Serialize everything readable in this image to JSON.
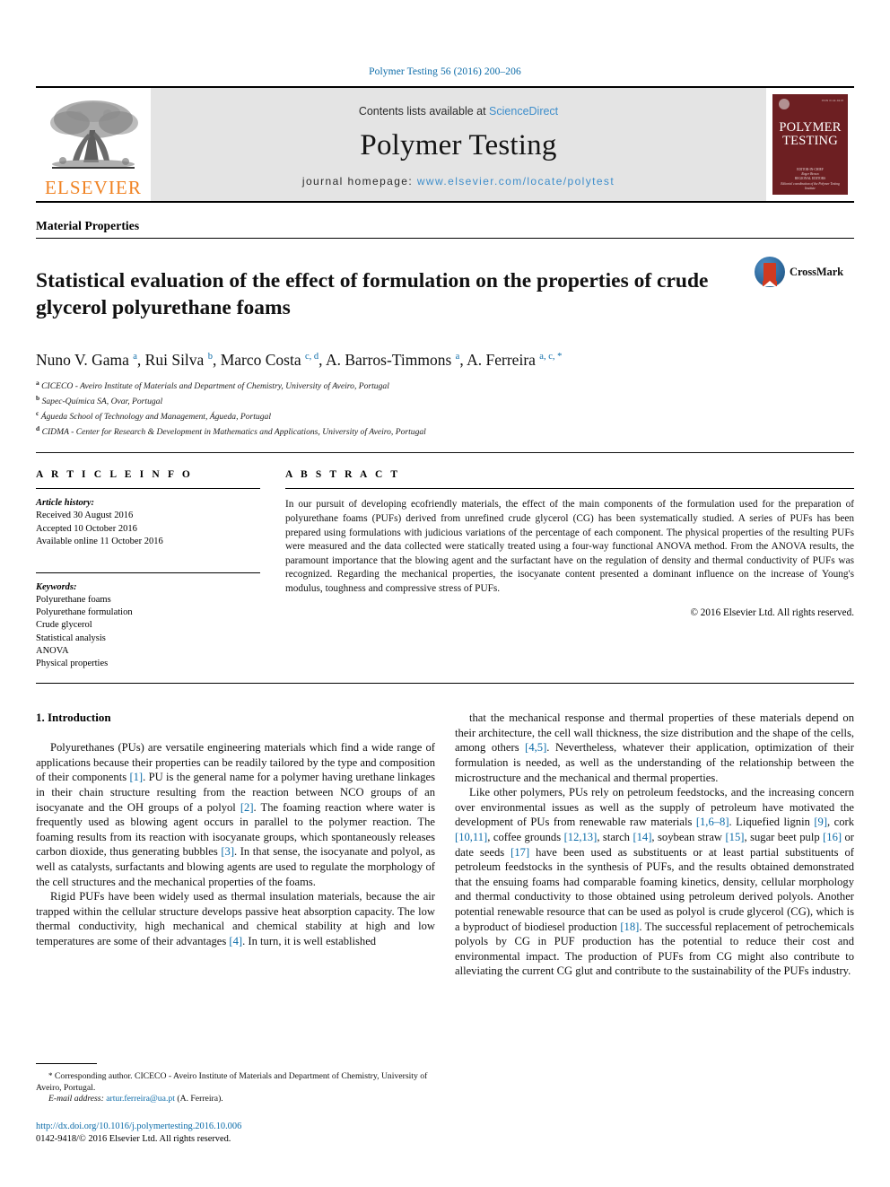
{
  "running_head": "Polymer Testing 56 (2016) 200–206",
  "masthead": {
    "publisher": "ELSEVIER",
    "contents_prefix": "Contents lists available at ",
    "contents_link": "ScienceDirect",
    "journal_title": "Polymer Testing",
    "homepage_prefix": "journal homepage: ",
    "homepage_url": "www.elsevier.com/locate/polytest",
    "cover": {
      "title_line1": "POLYMER",
      "title_line2": "TESTING",
      "issn": "ISSN 0142-9418",
      "meta_line1": "EDITOR-IN-CHIEF",
      "meta_line2": "Roger Brown",
      "meta_line3": "REGIONAL EDITORS",
      "meta_line4": "Editorial coordination of the Polymer Testing Institute"
    }
  },
  "article": {
    "section": "Material Properties",
    "title": "Statistical evaluation of the effect of formulation on the properties of crude glycerol polyurethane foams",
    "crossmark_label": "CrossMark",
    "authors": [
      {
        "name": "Nuno V. Gama",
        "sup": "a",
        "sep": ", "
      },
      {
        "name": "Rui Silva",
        "sup": "b",
        "sep": ", "
      },
      {
        "name": "Marco Costa",
        "sup": "c, d",
        "sep": ", "
      },
      {
        "name": "A. Barros-Timmons",
        "sup": "a",
        "sep": ", "
      },
      {
        "name": "A. Ferreira",
        "sup": "a, c, *",
        "sep": ""
      }
    ],
    "affiliations": [
      {
        "mark": "a",
        "text": "CICECO - Aveiro Institute of Materials and Department of Chemistry, University of Aveiro, Portugal"
      },
      {
        "mark": "b",
        "text": "Sapec-Química SA, Ovar, Portugal"
      },
      {
        "mark": "c",
        "text": "Águeda School of Technology and Management, Águeda, Portugal"
      },
      {
        "mark": "d",
        "text": "CIDMA - Center for Research & Development in Mathematics and Applications, University of Aveiro, Portugal"
      }
    ]
  },
  "article_info": {
    "heading": "A R T I C L E   I N F O",
    "history_label": "Article history:",
    "history": [
      "Received 30 August 2016",
      "Accepted 10 October 2016",
      "Available online 11 October 2016"
    ],
    "keywords_label": "Keywords:",
    "keywords": [
      "Polyurethane foams",
      "Polyurethane formulation",
      "Crude glycerol",
      "Statistical analysis",
      "ANOVA",
      "Physical properties"
    ]
  },
  "abstract": {
    "heading": "A B S T R A C T",
    "text": "In our pursuit of developing ecofriendly materials, the effect of the main components of the formulation used for the preparation of polyurethane foams (PUFs) derived from unrefined crude glycerol (CG) has been systematically studied. A series of PUFs has been prepared using formulations with judicious variations of the percentage of each component. The physical properties of the resulting PUFs were measured and the data collected were statically treated using a four-way functional ANOVA method. From the ANOVA results, the paramount importance that the blowing agent and the surfactant have on the regulation of density and thermal conductivity of PUFs was recognized. Regarding the mechanical properties, the isocyanate content presented a dominant influence on the increase of Young's modulus, toughness and compressive stress of PUFs.",
    "copyright": "© 2016 Elsevier Ltd. All rights reserved."
  },
  "body": {
    "heading": "1. Introduction",
    "left_paragraphs": [
      "Polyurethanes (PUs) are versatile engineering materials which find a wide range of applications because their properties can be readily tailored by the type and composition of their components [1]. PU is the general name for a polymer having urethane linkages in their chain structure resulting from the reaction between NCO groups of an isocyanate and the OH groups of a polyol [2]. The foaming reaction where water is frequently used as blowing agent occurs in parallel to the polymer reaction. The foaming results from its reaction with isocyanate groups, which spontaneously releases carbon dioxide, thus generating bubbles [3]. In that sense, the isocyanate and polyol, as well as catalysts, surfactants and blowing agents are used to regulate the morphology of the cell structures and the mechanical properties of the foams.",
      "Rigid PUFs have been widely used as thermal insulation materials, because the air trapped within the cellular structure develops passive heat absorption capacity. The low thermal conductivity, high mechanical and chemical stability at high and low temperatures are some of their advantages [4]. In turn, it is well established"
    ],
    "right_paragraphs": [
      "that the mechanical response and thermal properties of these materials depend on their architecture, the cell wall thickness, the size distribution and the shape of the cells, among others [4,5]. Nevertheless, whatever their application, optimization of their formulation is needed, as well as the understanding of the relationship between the microstructure and the mechanical and thermal properties.",
      "Like other polymers, PUs rely on petroleum feedstocks, and the increasing concern over environmental issues as well as the supply of petroleum have motivated the development of PUs from renewable raw materials [1,6–8]. Liquefied lignin [9], cork [10,11], coffee grounds [12,13], starch [14], soybean straw [15], sugar beet pulp [16] or date seeds [17] have been used as substituents or at least partial substituents of petroleum feedstocks in the synthesis of PUFs, and the results obtained demonstrated that the ensuing foams had comparable foaming kinetics, density, cellular morphology and thermal conductivity to those obtained using petroleum derived polyols. Another potential renewable resource that can be used as polyol is crude glycerol (CG), which is a byproduct of biodiesel production [18]. The successful replacement of petrochemicals polyols by CG in PUF production has the potential to reduce their cost and environmental impact. The production of PUFs from CG might also contribute to alleviating the current CG glut and contribute to the sustainability of the PUFs industry."
    ]
  },
  "footnote": {
    "star": "*",
    "corresponding": "Corresponding author. CICECO - Aveiro Institute of Materials and Department of Chemistry, University of Aveiro, Portugal.",
    "email_label": "E-mail address:",
    "email": "artur.ferreira@ua.pt",
    "email_owner": "(A. Ferreira).",
    "doi_url": "http://dx.doi.org/10.1016/j.polymertesting.2016.10.006",
    "issn_line": "0142-9418/© 2016 Elsevier Ltd. All rights reserved."
  },
  "colors": {
    "link_blue": "#0b6ba8",
    "elsevier_orange": "#f08222",
    "cover_maroon": "#6d1f22",
    "band_gray": "#e4e4e4"
  }
}
